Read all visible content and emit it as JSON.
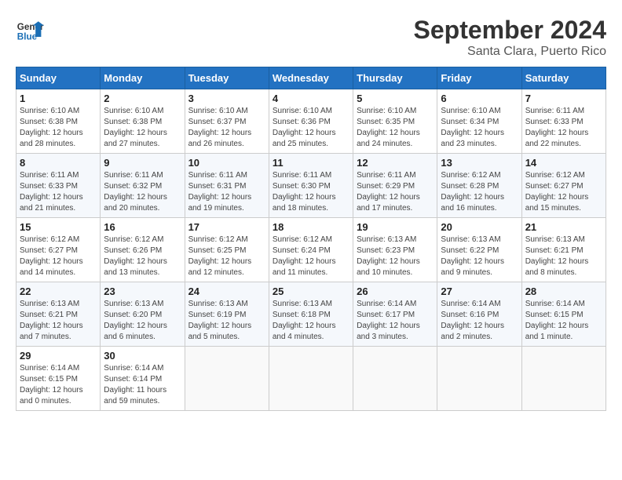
{
  "logo": {
    "line1": "General",
    "line2": "Blue"
  },
  "title": "September 2024",
  "subtitle": "Santa Clara, Puerto Rico",
  "days_of_week": [
    "Sunday",
    "Monday",
    "Tuesday",
    "Wednesday",
    "Thursday",
    "Friday",
    "Saturday"
  ],
  "weeks": [
    [
      {
        "num": "1",
        "sunrise": "6:10 AM",
        "sunset": "6:38 PM",
        "daylight": "12 hours and 28 minutes."
      },
      {
        "num": "2",
        "sunrise": "6:10 AM",
        "sunset": "6:38 PM",
        "daylight": "12 hours and 27 minutes."
      },
      {
        "num": "3",
        "sunrise": "6:10 AM",
        "sunset": "6:37 PM",
        "daylight": "12 hours and 26 minutes."
      },
      {
        "num": "4",
        "sunrise": "6:10 AM",
        "sunset": "6:36 PM",
        "daylight": "12 hours and 25 minutes."
      },
      {
        "num": "5",
        "sunrise": "6:10 AM",
        "sunset": "6:35 PM",
        "daylight": "12 hours and 24 minutes."
      },
      {
        "num": "6",
        "sunrise": "6:10 AM",
        "sunset": "6:34 PM",
        "daylight": "12 hours and 23 minutes."
      },
      {
        "num": "7",
        "sunrise": "6:11 AM",
        "sunset": "6:33 PM",
        "daylight": "12 hours and 22 minutes."
      }
    ],
    [
      {
        "num": "8",
        "sunrise": "6:11 AM",
        "sunset": "6:33 PM",
        "daylight": "12 hours and 21 minutes."
      },
      {
        "num": "9",
        "sunrise": "6:11 AM",
        "sunset": "6:32 PM",
        "daylight": "12 hours and 20 minutes."
      },
      {
        "num": "10",
        "sunrise": "6:11 AM",
        "sunset": "6:31 PM",
        "daylight": "12 hours and 19 minutes."
      },
      {
        "num": "11",
        "sunrise": "6:11 AM",
        "sunset": "6:30 PM",
        "daylight": "12 hours and 18 minutes."
      },
      {
        "num": "12",
        "sunrise": "6:11 AM",
        "sunset": "6:29 PM",
        "daylight": "12 hours and 17 minutes."
      },
      {
        "num": "13",
        "sunrise": "6:12 AM",
        "sunset": "6:28 PM",
        "daylight": "12 hours and 16 minutes."
      },
      {
        "num": "14",
        "sunrise": "6:12 AM",
        "sunset": "6:27 PM",
        "daylight": "12 hours and 15 minutes."
      }
    ],
    [
      {
        "num": "15",
        "sunrise": "6:12 AM",
        "sunset": "6:27 PM",
        "daylight": "12 hours and 14 minutes."
      },
      {
        "num": "16",
        "sunrise": "6:12 AM",
        "sunset": "6:26 PM",
        "daylight": "12 hours and 13 minutes."
      },
      {
        "num": "17",
        "sunrise": "6:12 AM",
        "sunset": "6:25 PM",
        "daylight": "12 hours and 12 minutes."
      },
      {
        "num": "18",
        "sunrise": "6:12 AM",
        "sunset": "6:24 PM",
        "daylight": "12 hours and 11 minutes."
      },
      {
        "num": "19",
        "sunrise": "6:13 AM",
        "sunset": "6:23 PM",
        "daylight": "12 hours and 10 minutes."
      },
      {
        "num": "20",
        "sunrise": "6:13 AM",
        "sunset": "6:22 PM",
        "daylight": "12 hours and 9 minutes."
      },
      {
        "num": "21",
        "sunrise": "6:13 AM",
        "sunset": "6:21 PM",
        "daylight": "12 hours and 8 minutes."
      }
    ],
    [
      {
        "num": "22",
        "sunrise": "6:13 AM",
        "sunset": "6:21 PM",
        "daylight": "12 hours and 7 minutes."
      },
      {
        "num": "23",
        "sunrise": "6:13 AM",
        "sunset": "6:20 PM",
        "daylight": "12 hours and 6 minutes."
      },
      {
        "num": "24",
        "sunrise": "6:13 AM",
        "sunset": "6:19 PM",
        "daylight": "12 hours and 5 minutes."
      },
      {
        "num": "25",
        "sunrise": "6:13 AM",
        "sunset": "6:18 PM",
        "daylight": "12 hours and 4 minutes."
      },
      {
        "num": "26",
        "sunrise": "6:14 AM",
        "sunset": "6:17 PM",
        "daylight": "12 hours and 3 minutes."
      },
      {
        "num": "27",
        "sunrise": "6:14 AM",
        "sunset": "6:16 PM",
        "daylight": "12 hours and 2 minutes."
      },
      {
        "num": "28",
        "sunrise": "6:14 AM",
        "sunset": "6:15 PM",
        "daylight": "12 hours and 1 minute."
      }
    ],
    [
      {
        "num": "29",
        "sunrise": "6:14 AM",
        "sunset": "6:15 PM",
        "daylight": "12 hours and 0 minutes."
      },
      {
        "num": "30",
        "sunrise": "6:14 AM",
        "sunset": "6:14 PM",
        "daylight": "11 hours and 59 minutes."
      },
      null,
      null,
      null,
      null,
      null
    ]
  ]
}
